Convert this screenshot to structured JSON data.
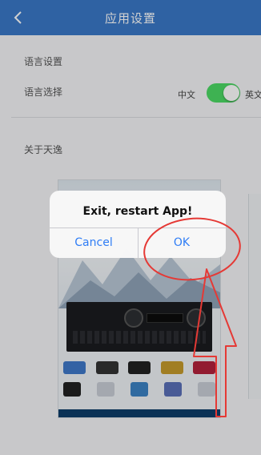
{
  "navbar": {
    "title": "应用设置",
    "back_icon": "chevron-left-icon",
    "color": "#3a78c7"
  },
  "settings": {
    "section_title": "语言设置",
    "language_row_label": "语言选择",
    "option_left": "中文",
    "option_right": "英文",
    "toggle_on": true,
    "toggle_color": "#4cd964",
    "about_label": "关于天逸"
  },
  "alert": {
    "message": "Exit, restart App!",
    "cancel_label": "Cancel",
    "ok_label": "OK",
    "button_color": "#2f7df6"
  },
  "annotation": {
    "color": "#e53935",
    "shapes": [
      "ellipse-highlight-ok",
      "arrow-pointing-up"
    ]
  }
}
